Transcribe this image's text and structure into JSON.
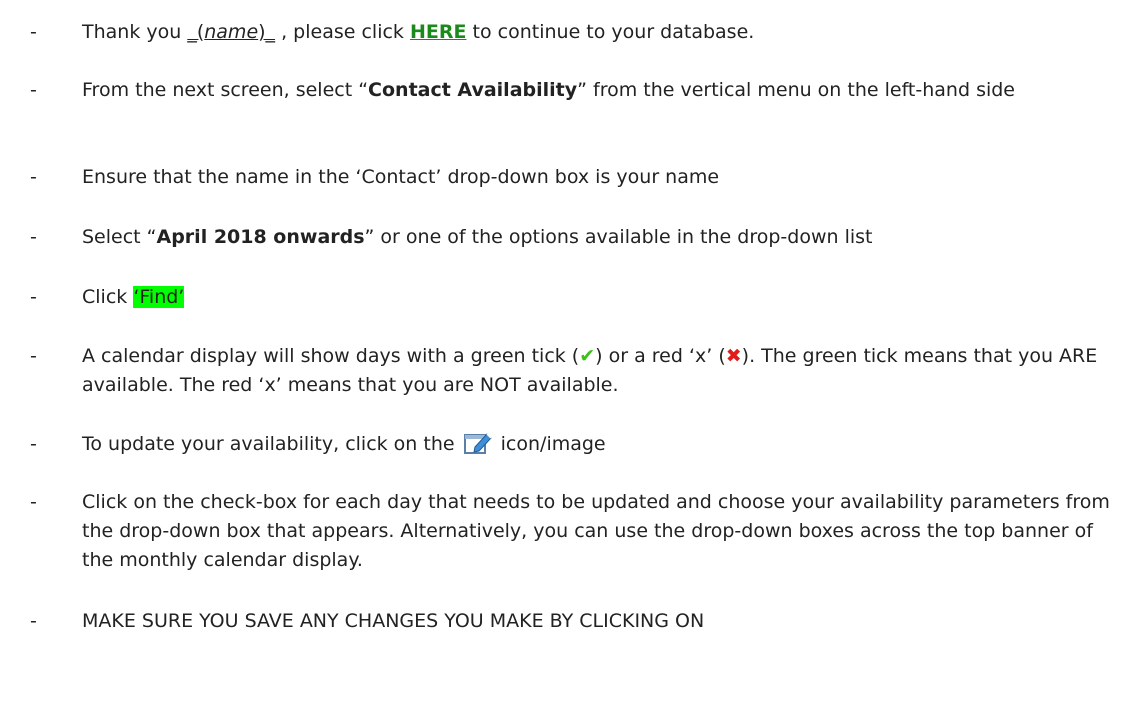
{
  "items": [
    {
      "id": "thank-you",
      "pre": "Thank you ",
      "name_prefix": "_(",
      "name_word": "name",
      "name_suffix": ")_",
      "mid": " , please click ",
      "link": "HERE",
      "post": " to continue to your database."
    },
    {
      "id": "contact-availability",
      "pre": "From the next screen, select “",
      "bold": "Contact Availability",
      "post": "” from the vertical menu on the left-hand side"
    },
    {
      "id": "ensure-name",
      "text": "Ensure that the name in the ‘Contact’ drop-down box is your name"
    },
    {
      "id": "select-april",
      "pre": "Select “",
      "bold": "April 2018 onwards",
      "post": "” or one of the options available in the drop-down list"
    },
    {
      "id": "click-find",
      "pre": "Click ",
      "highlight": "‘Find’"
    },
    {
      "id": "calendar",
      "pre": "A calendar display will show days with a green tick (",
      "tick": "✔",
      "mid": ") or a red ‘x’ (",
      "x": "✖",
      "post": ").  The green tick means that you ARE available.  The red ‘x’ means that you are NOT available."
    },
    {
      "id": "update",
      "pre": "To update your availability, click on the ",
      "post": " icon/image"
    },
    {
      "id": "checkbox",
      "text": "Click on the check-box for each day that needs to be updated and choose your availability parameters from the drop-down box that appears.  Alternatively, you can use the drop-down boxes across the top banner of the monthly calendar display."
    },
    {
      "id": "save",
      "text": "MAKE SURE YOU SAVE ANY CHANGES YOU MAKE BY CLICKING ON"
    }
  ],
  "bullet": "-",
  "colors": {
    "link": "#1a8a1a",
    "highlight": "#00ff00",
    "tick": "#3cc11b",
    "x": "#e01b1b"
  },
  "icons": [
    "green-tick-icon",
    "red-x-icon",
    "edit-icon"
  ]
}
